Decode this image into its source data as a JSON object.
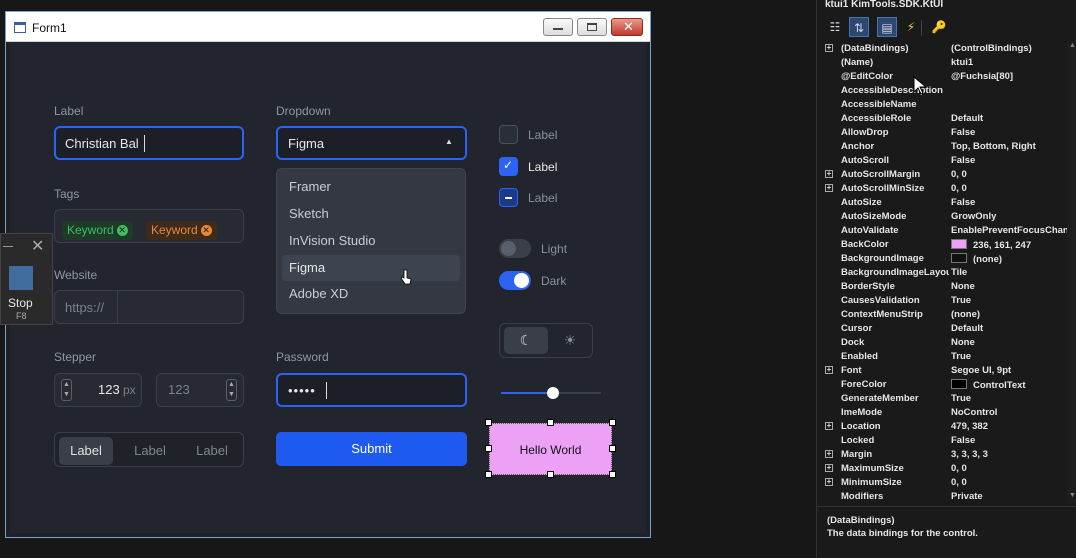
{
  "window": {
    "title": "Form1"
  },
  "fields": {
    "label_label": "Label",
    "label_value": "Christian Bal",
    "tags_label": "Tags",
    "tags": [
      {
        "text": "Keyword",
        "color": "#3fbd61",
        "bg": "#1e3a28"
      },
      {
        "text": "Keyword",
        "color": "#e8893a",
        "bg": "#3e2b1c"
      }
    ],
    "website_label": "Website",
    "website_prefix": "https://",
    "stepper_label": "Stepper",
    "stepper1_value": "123",
    "stepper1_unit": "px",
    "stepper2_value": "123",
    "dropdown_label": "Dropdown",
    "dropdown_selected": "Figma",
    "dropdown_options": [
      "Framer",
      "Sketch",
      "InVision Studio",
      "Figma",
      "Adobe XD"
    ],
    "password_label": "Password",
    "password_value": "•••••",
    "submit_label": "Submit",
    "checkbox_labels": [
      "Label",
      "Label",
      "Label"
    ],
    "toggle_labels": [
      "Light",
      "Dark"
    ],
    "segments": [
      "Label",
      "Label",
      "Label"
    ],
    "hello_label": "Hello World",
    "slider_value": 0.52
  },
  "stop_panel": {
    "label": "Stop",
    "shortcut": "F8"
  },
  "property_grid": {
    "header": "ktui1  KimTools.SDK.KtUI",
    "rows": [
      {
        "name": "(DataBindings)",
        "value": "(ControlBindings)",
        "expand": true
      },
      {
        "name": "(Name)",
        "value": "ktui1"
      },
      {
        "name": "@EditColor",
        "value": "@Fuchsia[80]"
      },
      {
        "name": "AccessibleDescription",
        "value": ""
      },
      {
        "name": "AccessibleName",
        "value": ""
      },
      {
        "name": "AccessibleRole",
        "value": "Default"
      },
      {
        "name": "AllowDrop",
        "value": "False"
      },
      {
        "name": "Anchor",
        "value": "Top, Bottom, Right"
      },
      {
        "name": "AutoScroll",
        "value": "False"
      },
      {
        "name": "AutoScrollMargin",
        "value": "0, 0",
        "expand": true
      },
      {
        "name": "AutoScrollMinSize",
        "value": "0, 0",
        "expand": true
      },
      {
        "name": "AutoSize",
        "value": "False"
      },
      {
        "name": "AutoSizeMode",
        "value": "GrowOnly"
      },
      {
        "name": "AutoValidate",
        "value": "EnablePreventFocusChange"
      },
      {
        "name": "BackColor",
        "value": "236, 161, 247",
        "swatch": "#eca1f7"
      },
      {
        "name": "BackgroundImage",
        "value": "(none)",
        "swatch": "#111111"
      },
      {
        "name": "BackgroundImageLayout",
        "value": "Tile"
      },
      {
        "name": "BorderStyle",
        "value": "None"
      },
      {
        "name": "CausesValidation",
        "value": "True"
      },
      {
        "name": "ContextMenuStrip",
        "value": "(none)"
      },
      {
        "name": "Cursor",
        "value": "Default"
      },
      {
        "name": "Dock",
        "value": "None"
      },
      {
        "name": "Enabled",
        "value": "True"
      },
      {
        "name": "Font",
        "value": "Segoe UI, 9pt",
        "expand": true
      },
      {
        "name": "ForeColor",
        "value": "ControlText",
        "swatch": "#000000"
      },
      {
        "name": "GenerateMember",
        "value": "True"
      },
      {
        "name": "ImeMode",
        "value": "NoControl"
      },
      {
        "name": "Location",
        "value": "479, 382",
        "expand": true
      },
      {
        "name": "Locked",
        "value": "False"
      },
      {
        "name": "Margin",
        "value": "3, 3, 3, 3",
        "expand": true
      },
      {
        "name": "MaximumSize",
        "value": "0, 0",
        "expand": true
      },
      {
        "name": "MinimumSize",
        "value": "0, 0",
        "expand": true
      },
      {
        "name": "Modifiers",
        "value": "Private"
      }
    ],
    "desc_title": "(DataBindings)",
    "desc_text": "The data bindings for the control."
  },
  "colors": {
    "accent": "#2d63f2",
    "hello_bg": "#eca1f7",
    "window_bg": "#22252d"
  }
}
